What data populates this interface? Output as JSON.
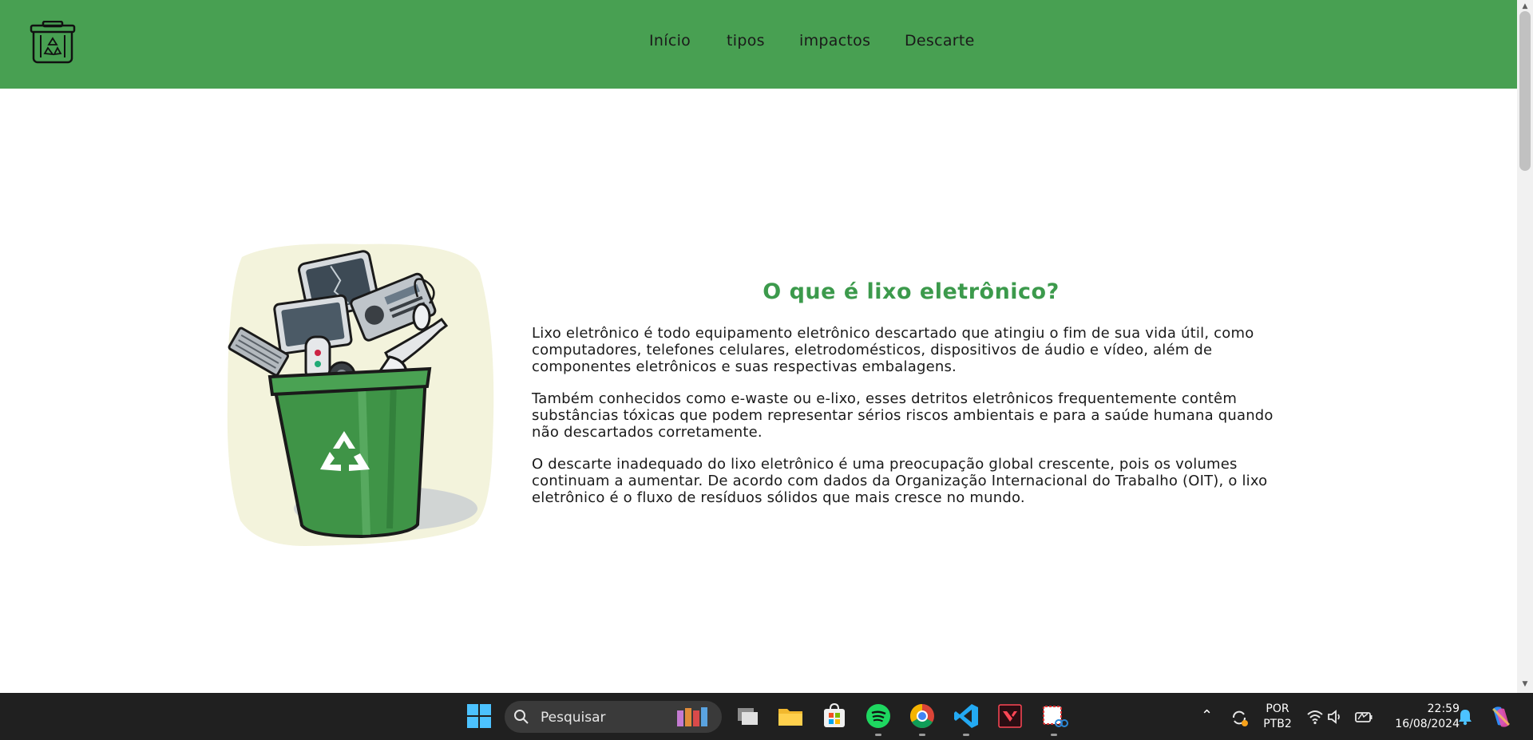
{
  "nav": {
    "items": [
      {
        "label": "Início"
      },
      {
        "label": "tipos"
      },
      {
        "label": "impactos"
      },
      {
        "label": "Descarte"
      }
    ]
  },
  "main": {
    "title": "O que é lixo eletrônico?",
    "paragraphs": [
      "Lixo eletrônico é todo equipamento eletrônico descartado que atingiu o fim de sua vida útil, como computadores, telefones celulares, eletrodomésticos, dispositivos de áudio e vídeo, além de componentes eletrônicos e suas respectivas embalagens.",
      "Também conhecidos como e-waste ou e-lixo, esses detritos eletrônicos frequentemente contêm substâncias tóxicas que podem representar sérios riscos ambientais e para a saúde humana quando não descartados corretamente.",
      "O descarte inadequado do lixo eletrônico é uma preocupação global crescente, pois os volumes continuam a aumentar. De acordo com dados da Organização Internacional do Trabalho (OIT), o lixo eletrônico é o fluxo de resíduos sólidos que mais cresce no mundo."
    ]
  },
  "taskbar": {
    "search_placeholder": "Pesquisar",
    "language_line1": "POR",
    "language_line2": "PTB2",
    "time": "22:59",
    "date": "16/08/2024",
    "apps": [
      "start-icon",
      "task-view-icon",
      "file-explorer-icon",
      "microsoft-store-icon",
      "spotify-icon",
      "chrome-icon",
      "vscode-icon",
      "valorant-icon",
      "snipping-tool-icon"
    ]
  },
  "colors": {
    "header_bg": "#48a052",
    "title": "#3c9a4c",
    "taskbar_bg": "#202020"
  }
}
